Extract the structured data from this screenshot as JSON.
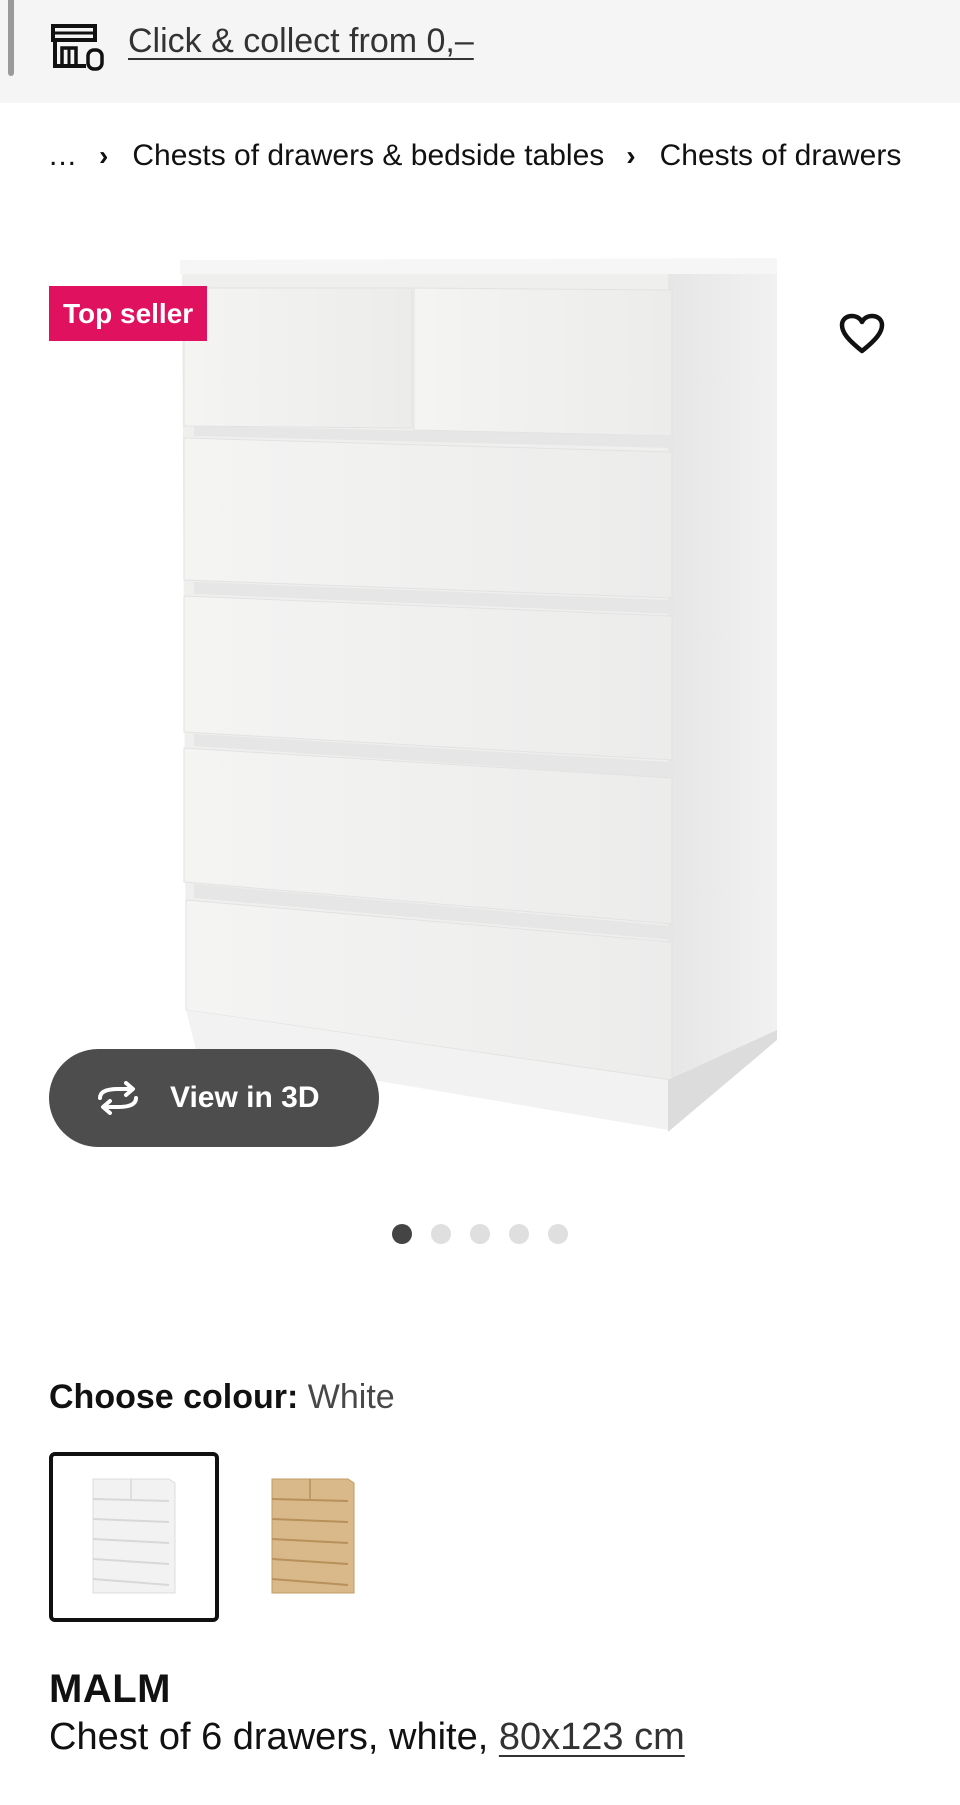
{
  "header": {
    "collect_label": "Click & collect from 0,–",
    "store_icon": "store-pickup-icon"
  },
  "breadcrumb": {
    "ellipsis": "...",
    "items": [
      "Chests of drawers & bedside tables",
      "Chests of drawers"
    ],
    "separator_icon": "chevron-right-icon"
  },
  "gallery": {
    "badge": "Top seller",
    "badge_color": "#e0115f",
    "favourite_icon": "heart-outline-icon",
    "view3d_label": "View in 3D",
    "view3d_icon": "rotate-3d-icon",
    "image_count": 5,
    "active_index": 0
  },
  "colour": {
    "label": "Choose colour:",
    "value": "White",
    "swatches": [
      {
        "name": "white",
        "selected": true
      },
      {
        "name": "oak",
        "selected": false
      }
    ]
  },
  "product": {
    "name": "MALM",
    "description": "Chest of 6 drawers, white, ",
    "size": "80x123 cm"
  }
}
